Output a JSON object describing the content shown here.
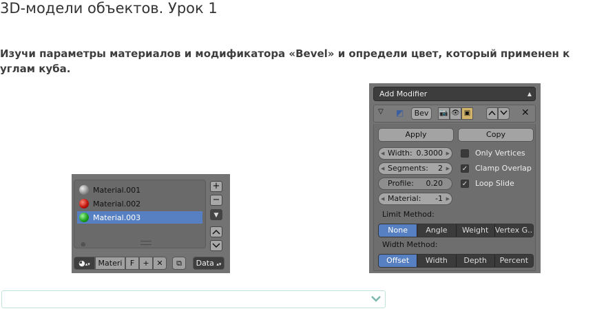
{
  "page": {
    "title": "3D-модели объектов. Урок 1",
    "question": "Изучи параметры материалов и модификатора «Bevel» и определи цвет, который применен к углам куба."
  },
  "materials": {
    "items": [
      {
        "label": "Material.001",
        "color": "#9a9a9a",
        "selected": false
      },
      {
        "label": "Material.002",
        "color": "#c0150b",
        "selected": false
      },
      {
        "label": "Material.003",
        "color": "#1ea11e",
        "selected": true
      }
    ],
    "bottom_bar": {
      "name_field": "Materi",
      "fake_user": "F",
      "data_select": "Data"
    }
  },
  "modifier": {
    "add_modifier": "Add Modifier",
    "name": "Bev",
    "apply": "Apply",
    "copy": "Copy",
    "fields": [
      {
        "label": "Width:",
        "value": "0.3000"
      },
      {
        "label": "Segments:",
        "value": "2"
      },
      {
        "label": "Profile:",
        "value": "0.20"
      },
      {
        "label": "Material:",
        "value": "-1"
      }
    ],
    "checkboxes": [
      {
        "label": "Only Vertices",
        "checked": false
      },
      {
        "label": "Clamp Overlap",
        "checked": true
      },
      {
        "label": "Loop Slide",
        "checked": true
      }
    ],
    "limit_method": {
      "label": "Limit Method:",
      "options": [
        "None",
        "Angle",
        "Weight",
        "Vertex G..."
      ],
      "selected": "None"
    },
    "width_method": {
      "label": "Width Method:",
      "options": [
        "Offset",
        "Width",
        "Depth",
        "Percent"
      ],
      "selected": "Offset"
    }
  },
  "answer": {
    "value": ""
  },
  "colors": {
    "selection": "#5680c2",
    "panel": "#737373",
    "answer_border": "#bfe4dc"
  }
}
